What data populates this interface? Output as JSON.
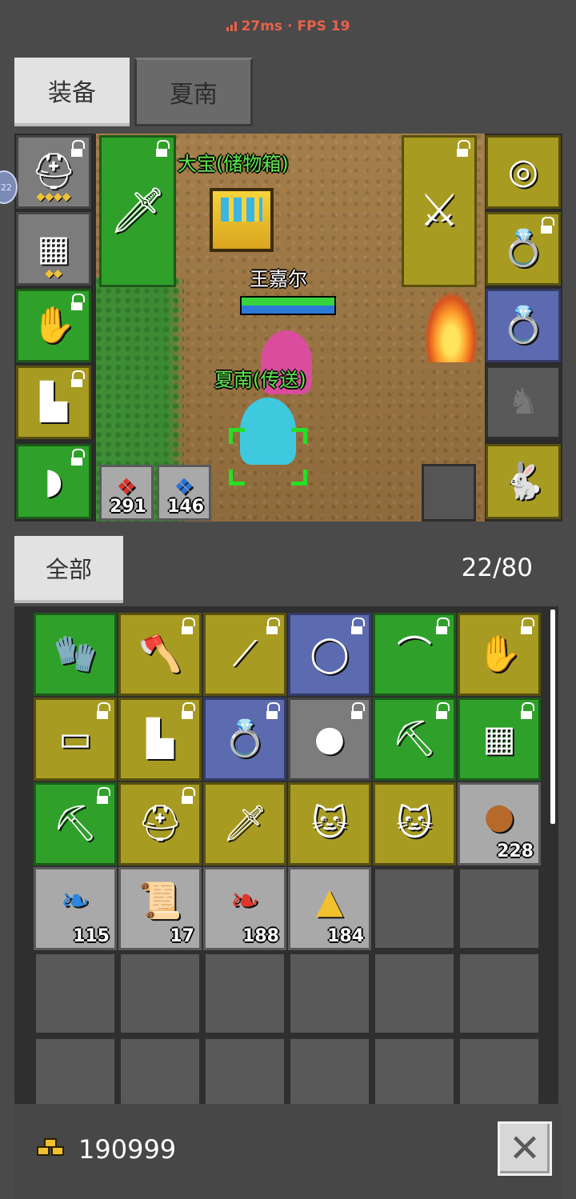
{
  "status": {
    "ping": "27ms",
    "sep": "·",
    "fps": "FPS 19"
  },
  "tabs": [
    {
      "label": "装备",
      "active": true
    },
    {
      "label": "夏南",
      "active": false
    }
  ],
  "side_badge": "22",
  "scene": {
    "storage_label": "大宝(储物箱)",
    "player_name": "王嘉尔",
    "pet_label": "夏南(传送)",
    "hp_ratio": 1.0,
    "mp_ratio": 1.0
  },
  "equipment": {
    "left_column": [
      {
        "icon": "helmet-icon",
        "rarity": "grey",
        "locked": true,
        "stars": "◆◆◆◆"
      },
      {
        "icon": "armor-icon",
        "rarity": "grey",
        "locked": false,
        "stars": "◆◆"
      },
      {
        "icon": "gloves-icon",
        "rarity": "green",
        "locked": true
      },
      {
        "icon": "boots-icon",
        "rarity": "yellow",
        "locked": true
      },
      {
        "icon": "cap-icon",
        "rarity": "green",
        "locked": true
      }
    ],
    "weapon_main": {
      "icon": "purple-sword-icon",
      "rarity": "green",
      "locked": true
    },
    "weapon_off": {
      "icon": "iron-sword-icon",
      "rarity": "yellow",
      "locked": true
    },
    "right_column": [
      {
        "icon": "emerald-necklace-icon",
        "rarity": "yellow",
        "locked": false
      },
      {
        "icon": "amethyst-ring-icon",
        "rarity": "yellow",
        "locked": true
      },
      {
        "icon": "topaz-ring-icon",
        "rarity": "blue",
        "locked": false
      },
      {
        "icon": "empty-accessory-icon",
        "rarity": "dark",
        "locked": false
      },
      {
        "icon": "rabbit-pet-icon",
        "rarity": "yellow",
        "locked": false
      }
    ],
    "quick_slots": [
      {
        "icon": "red-potion-icon",
        "qty": "291"
      },
      {
        "icon": "blue-potion-icon",
        "qty": "146"
      }
    ]
  },
  "inventory": {
    "filter_label": "全部",
    "count": "22/80",
    "items": [
      {
        "icon": "blue-gauntlet-icon",
        "rarity": "green",
        "locked": false
      },
      {
        "icon": "axe-icon",
        "rarity": "yellow",
        "locked": true
      },
      {
        "icon": "spear-icon",
        "rarity": "yellow",
        "locked": true
      },
      {
        "icon": "gold-ring-icon",
        "rarity": "blue",
        "locked": true
      },
      {
        "icon": "bow-icon",
        "rarity": "green",
        "locked": true
      },
      {
        "icon": "leather-glove-icon",
        "rarity": "yellow",
        "locked": true
      },
      {
        "icon": "belt-icon",
        "rarity": "yellow",
        "locked": true
      },
      {
        "icon": "leather-boots-icon",
        "rarity": "yellow",
        "locked": true
      },
      {
        "icon": "ruby-ring-icon",
        "rarity": "blue",
        "locked": true
      },
      {
        "icon": "stone-amulet-icon",
        "rarity": "grey",
        "locked": true
      },
      {
        "icon": "pickaxe-icon",
        "rarity": "green",
        "locked": true
      },
      {
        "icon": "chest-armor-icon",
        "rarity": "green",
        "locked": true
      },
      {
        "icon": "pickaxe-icon",
        "rarity": "green",
        "locked": true
      },
      {
        "icon": "helmet-icon",
        "rarity": "yellow",
        "locked": true
      },
      {
        "icon": "dagger-icon",
        "rarity": "yellow",
        "locked": false
      },
      {
        "icon": "cat-pet-icon",
        "rarity": "yellow",
        "locked": false
      },
      {
        "icon": "cat-pet-icon",
        "rarity": "yellow",
        "locked": false
      },
      {
        "icon": "meat-icon",
        "rarity": "light",
        "locked": false,
        "qty": "228"
      },
      {
        "icon": "blue-feather-icon",
        "rarity": "light",
        "locked": false,
        "qty": "115"
      },
      {
        "icon": "scroll-icon",
        "rarity": "light",
        "locked": false,
        "qty": "17"
      },
      {
        "icon": "red-feather-icon",
        "rarity": "light",
        "locked": false,
        "qty": "188"
      },
      {
        "icon": "gold-pile-icon",
        "rarity": "light",
        "locked": false,
        "qty": "184"
      }
    ],
    "empty_slots_visible": 20
  },
  "footer": {
    "gold": "190999",
    "close_symbol": "✕"
  },
  "colors": {
    "green": "#2fa12a",
    "yellow": "#a89b22",
    "blue": "#5c6bb0",
    "grey": "#7c7c7c",
    "accent": "#e8624a"
  }
}
